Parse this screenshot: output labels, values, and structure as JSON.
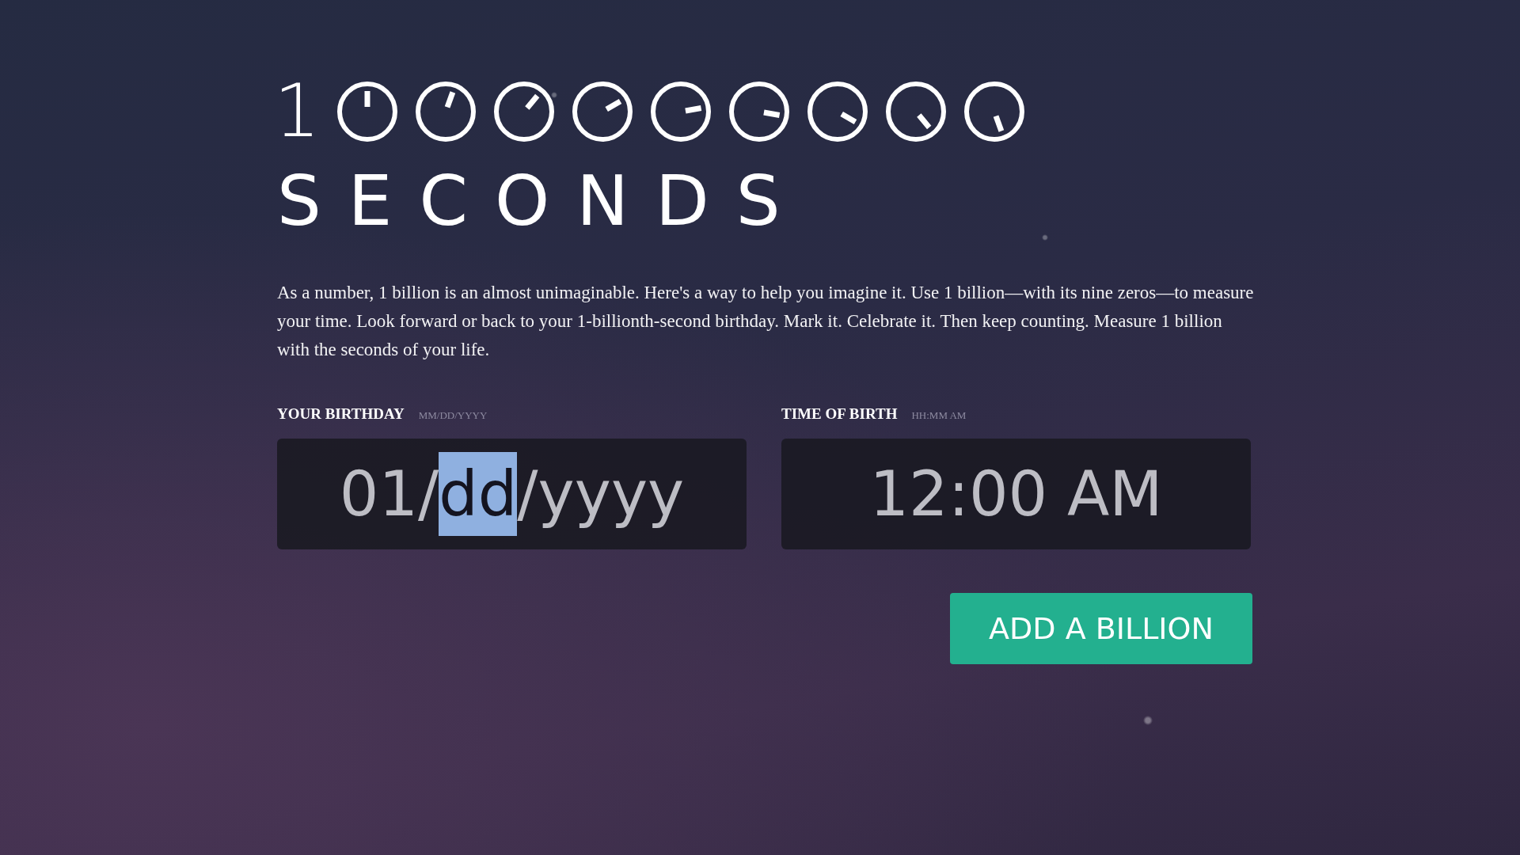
{
  "title": {
    "digit": "1",
    "word": "SECONDS"
  },
  "intro": "As a number, 1 billion is an almost unimaginable. Here's a way to help you imagine it. Use 1 billion—with its nine zeros—to measure your time. Look forward or back to your 1-billionth-second birthday. Mark it. Celebrate it. Then keep counting. Measure 1 billion with the seconds of your life.",
  "fields": [
    {
      "label": "YOUR BIRTHDAY",
      "format": "MM/DD/YYYY",
      "segments": [
        {
          "text": "01",
          "selected": false
        },
        {
          "text": "/",
          "selected": false
        },
        {
          "text": "dd",
          "selected": true
        },
        {
          "text": "/",
          "selected": false
        },
        {
          "text": "yyyy",
          "selected": false
        }
      ]
    },
    {
      "label": "TIME OF BIRTH",
      "format": "HH:MM AM",
      "segments": [
        {
          "text": "12:00 AM",
          "selected": false
        }
      ]
    }
  ],
  "button": "ADD A BILLION"
}
